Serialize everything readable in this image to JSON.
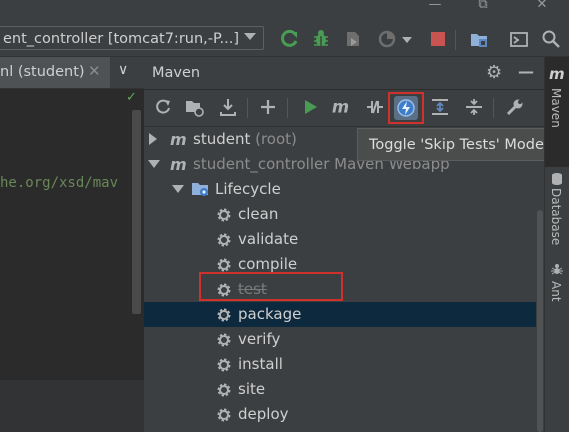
{
  "window": {
    "minimize_glyph": "—",
    "restore_glyph": "⧉",
    "close_glyph": "✕"
  },
  "toolbar": {
    "run_config": "ent_controller [tomcat7:run,-P...]",
    "icons": [
      "hammer-rerun-icon",
      "debug-bug-icon",
      "profile-icon",
      "coverage-icon",
      "stop-icon",
      "project-structure-icon",
      "terminal-icon",
      "search-icon"
    ]
  },
  "editor": {
    "tab_label": "nl (student)",
    "tab_close": "✕",
    "tab_chevron": "∨",
    "code_line": "he.org/xsd/mav",
    "check": "✓"
  },
  "maven": {
    "title": "Maven",
    "settings_glyph": "⚙",
    "hide_glyph": "—",
    "tooltip": "Toggle 'Skip Tests' Mode",
    "tools": [
      "reload-icon",
      "reimport-folder-icon",
      "download-icon",
      "add-icon",
      "run-icon",
      "execute-goal-icon",
      "toggle-offline-icon",
      "skip-tests-icon",
      "expand-all-icon",
      "collapse-all-icon",
      "settings-wrench-icon"
    ],
    "tree": {
      "root1_name": "student",
      "root1_suffix": " (root)",
      "root2_name": "student_controller",
      "root2_suffix": " Maven Webapp",
      "lifecycle": "Lifecycle",
      "goals": [
        "clean",
        "validate",
        "compile",
        "test",
        "package",
        "verify",
        "install",
        "site",
        "deploy"
      ],
      "skipped_goal": "test",
      "selected_goal": "package"
    }
  },
  "right_strip": {
    "maven_label": "Maven",
    "database_label": "Database",
    "ant_label": "Ant"
  },
  "colors": {
    "accent_red": "#d0312d",
    "selection": "#0d293e",
    "run_green": "#499c54",
    "stop_red": "#c75450"
  }
}
